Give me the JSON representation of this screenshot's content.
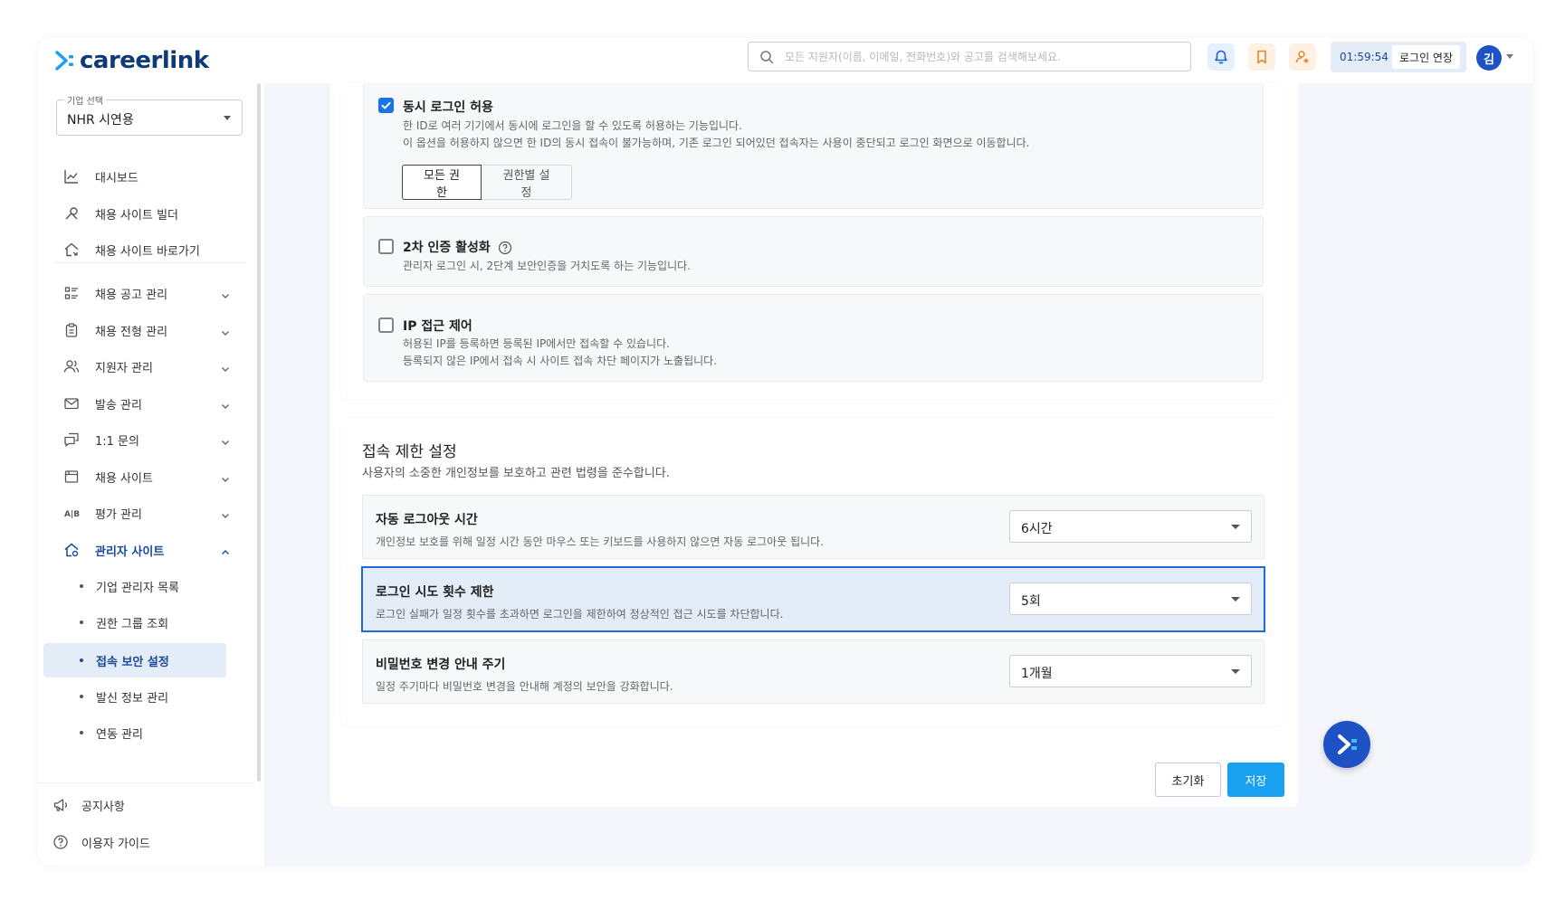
{
  "header": {
    "logo_text": "careerlink",
    "search_placeholder": "모든 지원자(이름, 이메일, 전화번호)와 공고를 검색해보세요.",
    "timer": "01:59:54",
    "extend_label": "로그인 연장",
    "avatar_initial": "김"
  },
  "sidebar": {
    "company_label": "기업 선택",
    "company_value": "NHR 시연용",
    "top_items": [
      {
        "label": "대시보드"
      },
      {
        "label": "채용 사이트 빌더"
      },
      {
        "label": "채용 사이트 바로가기"
      }
    ],
    "menu_items": [
      {
        "label": "채용 공고 관리"
      },
      {
        "label": "채용 전형 관리"
      },
      {
        "label": "지원자 관리"
      },
      {
        "label": "발송 관리"
      },
      {
        "label": "1:1 문의"
      },
      {
        "label": "채용 사이트"
      },
      {
        "label": "평가 관리"
      },
      {
        "label": "관리자 사이트"
      }
    ],
    "sub_items": [
      {
        "label": "기업 관리자 목록"
      },
      {
        "label": "권한 그룹 조회"
      },
      {
        "label": "접속 보안 설정"
      },
      {
        "label": "발신 정보 관리"
      },
      {
        "label": "연동 관리"
      }
    ],
    "bottom_items": [
      {
        "label": "공지사항"
      },
      {
        "label": "이용자 가이드"
      }
    ]
  },
  "security": {
    "concurrent": {
      "title": "동시 로그인 허용",
      "desc1": "한 ID로 여러 기기에서 동시에 로그인을 할 수 있도록 허용하는 기능입니다.",
      "desc2": "이 옵션을 허용하지 않으면 한 ID의 동시 접속이 불가능하며, 기존 로그인 되어있던 접속자는 사용이 중단되고 로그인 화면으로 이동합니다.",
      "seg_all": "모든 권한",
      "seg_by_role": "권한별 설정"
    },
    "two_factor": {
      "title": "2차 인증 활성화",
      "desc": "관리자 로그인 시, 2단계 보안인증을 거치도록 하는 기능입니다."
    },
    "ip_control": {
      "title": "IP 접근 제어",
      "desc1": "허용된 IP를 등록하면 등록된 IP에서만 접속할 수 있습니다.",
      "desc2": "등록되지 않은 IP에서 접속 시 사이트 접속 차단 페이지가 노출됩니다."
    }
  },
  "access_limit": {
    "title": "접속 제한 설정",
    "desc": "사용자의 소중한 개인정보를 보호하고 관련 법령을 준수합니다.",
    "rows": [
      {
        "title": "자동 로그아웃 시간",
        "desc": "개인정보 보호를 위해 일정 시간 동안 마우스 또는 키보드를 사용하지 않으면 자동 로그아웃 됩니다.",
        "value": "6시간"
      },
      {
        "title": "로그인 시도 횟수 제한",
        "desc": "로그인 실패가 일정 횟수를 초과하면 로그인을 제한하여 정상적인 접근 시도를 차단합니다.",
        "value": "5회"
      },
      {
        "title": "비밀번호 변경 안내 주기",
        "desc": "일정 주기마다 비밀번호 변경을 안내해 계정의 보안을 강화합니다.",
        "value": "1개월"
      }
    ]
  },
  "actions": {
    "reset": "초기화",
    "save": "저장"
  },
  "colors": {
    "brand": "#0e3a78",
    "accent": "#1a73e8",
    "save": "#1aa0f0",
    "highlight_border": "#1f6ad6"
  }
}
